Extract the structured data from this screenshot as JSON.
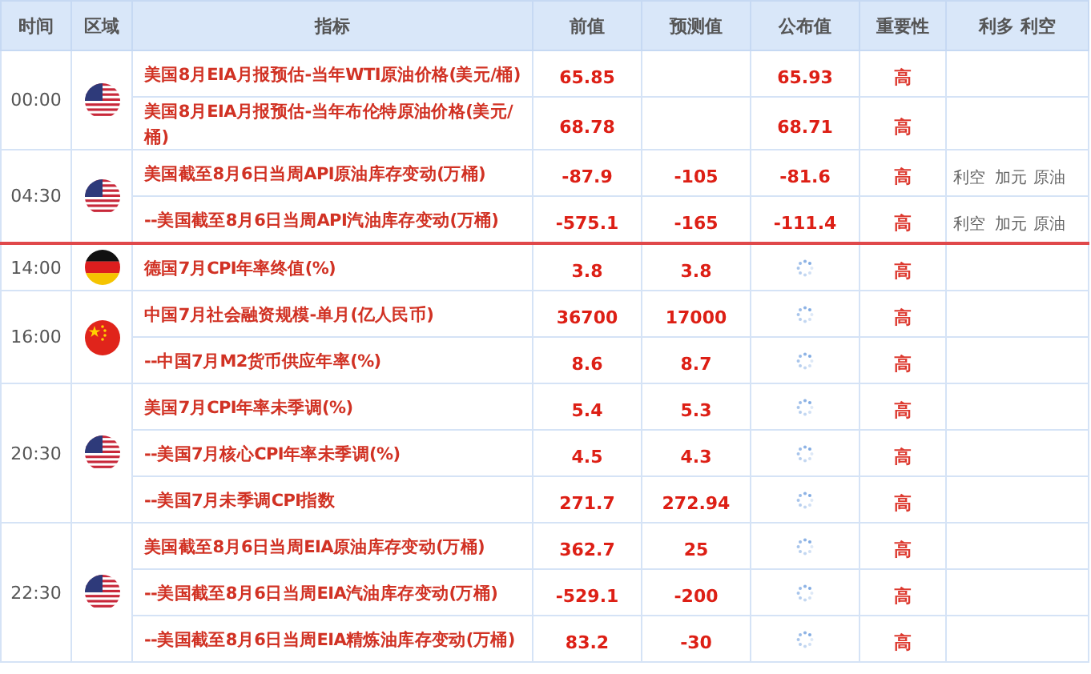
{
  "columns": [
    "时间",
    "区域",
    "指标",
    "前值",
    "预测值",
    "公布值",
    "重要性",
    "利多 利空"
  ],
  "groups": [
    {
      "time": "00:00",
      "kind": "us",
      "line_after": false,
      "rows": [
        {
          "indicator": "美国8月EIA月报预估-当年WTI原油价格(美元/桶)",
          "previous": "65.85",
          "released": true,
          "actual": "65.93",
          "importance": "高"
        },
        {
          "indicator": "美国8月EIA月报预估-当年布伦特原油价格(美元/桶)",
          "previous": "68.78",
          "released": true,
          "actual": "68.71",
          "importance": "高"
        }
      ]
    },
    {
      "time": "04:30",
      "kind": "us",
      "line_after": true,
      "rows": [
        {
          "indicator": "美国截至8月6日当周API原油库存变动(万桶)",
          "previous": "-87.9",
          "forecast": "-105",
          "released": true,
          "actual": "-81.6",
          "importance": "高",
          "impact": [
            "利空",
            "加元",
            "原油"
          ]
        },
        {
          "indicator": "--美国截至8月6日当周API汽油库存变动(万桶)",
          "previous": "-575.1",
          "forecast": "-165",
          "released": true,
          "actual": "-111.4",
          "importance": "高",
          "impact": [
            "利空",
            "加元",
            "原油"
          ]
        }
      ]
    },
    {
      "time": "14:00",
      "kind": "de",
      "line_after": false,
      "rows": [
        {
          "indicator": "德国7月CPI年率终值(%)",
          "previous": "3.8",
          "forecast": "3.8",
          "released": false,
          "importance": "高"
        }
      ]
    },
    {
      "time": "16:00",
      "kind": "cn",
      "line_after": false,
      "rows": [
        {
          "indicator": "中国7月社会融资规模-单月(亿人民币)",
          "previous": "36700",
          "forecast": "17000",
          "released": false,
          "importance": "高"
        },
        {
          "indicator": "--中国7月M2货币供应年率(%)",
          "previous": "8.6",
          "forecast": "8.7",
          "released": false,
          "importance": "高"
        }
      ]
    },
    {
      "time": "20:30",
      "kind": "us",
      "line_after": false,
      "rows": [
        {
          "indicator": "美国7月CPI年率未季调(%)",
          "previous": "5.4",
          "forecast": "5.3",
          "released": false,
          "importance": "高"
        },
        {
          "indicator": "--美国7月核心CPI年率未季调(%)",
          "previous": "4.5",
          "forecast": "4.3",
          "released": false,
          "importance": "高"
        },
        {
          "indicator": "--美国7月未季调CPI指数",
          "previous": "271.7",
          "forecast": "272.94",
          "released": false,
          "importance": "高"
        }
      ]
    },
    {
      "time": "22:30",
      "kind": "us",
      "line_after": false,
      "rows": [
        {
          "indicator": "美国截至8月6日当周EIA原油库存变动(万桶)",
          "previous": "362.7",
          "forecast": "25",
          "released": false,
          "importance": "高"
        },
        {
          "indicator": "--美国截至8月6日当周EIA汽油库存变动(万桶)",
          "previous": "-529.1",
          "forecast": "-200",
          "released": false,
          "importance": "高"
        },
        {
          "indicator": "--美国截至8月6日当周EIA精炼油库存变动(万桶)",
          "previous": "83.2",
          "forecast": "-30",
          "released": false,
          "importance": "高"
        }
      ]
    }
  ]
}
